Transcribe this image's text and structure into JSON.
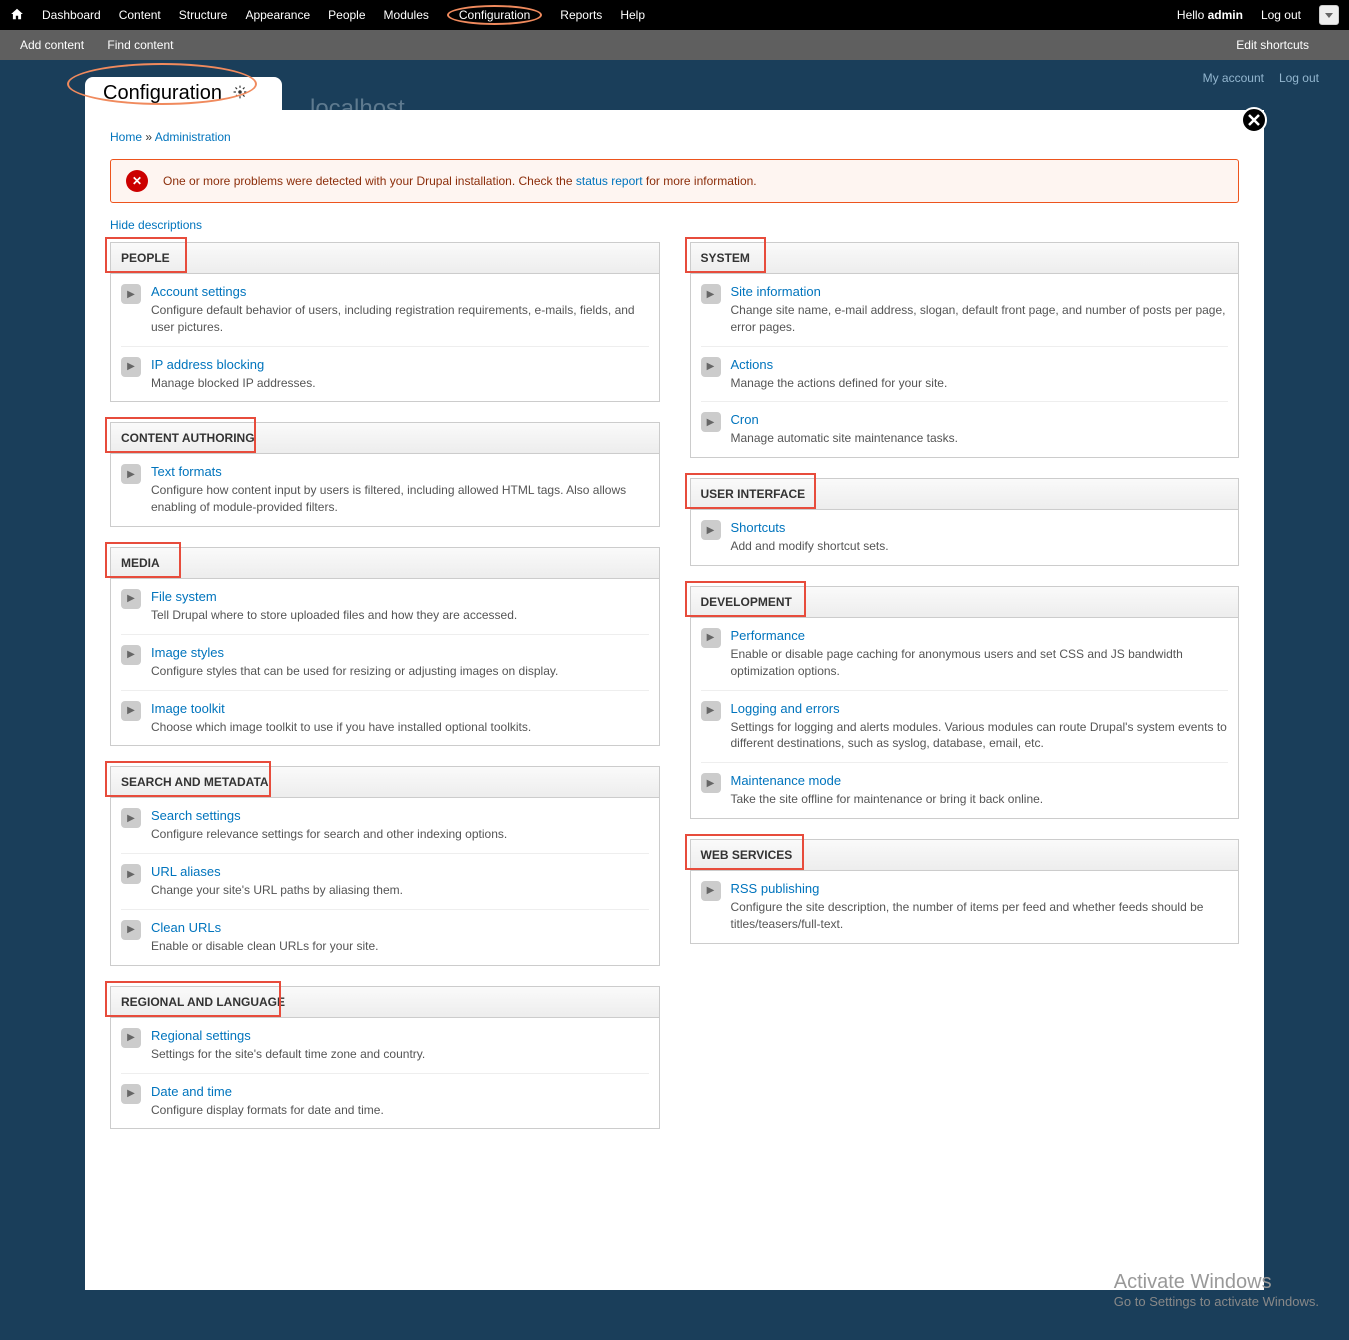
{
  "topbar": {
    "items": [
      "Dashboard",
      "Content",
      "Structure",
      "Appearance",
      "People",
      "Modules",
      "Configuration",
      "Reports",
      "Help"
    ],
    "hello": "Hello",
    "user": "admin",
    "logout": "Log out"
  },
  "shortcutbar": {
    "add": "Add content",
    "find": "Find content",
    "edit": "Edit shortcuts"
  },
  "userbar": {
    "account": "My account",
    "logout": "Log out"
  },
  "site_title": "localhost",
  "overlay_title": "Configuration",
  "breadcrumb": {
    "home": "Home",
    "sep": " » ",
    "admin": "Administration"
  },
  "status": {
    "pre": "One or more problems were detected with your Drupal installation. Check the ",
    "link": "status report",
    "post": " for more information."
  },
  "hide_desc": "Hide descriptions",
  "left_panels": [
    {
      "title": "PEOPLE",
      "box": "box-people",
      "items": [
        {
          "link": "Account settings",
          "desc": "Configure default behavior of users, including registration requirements, e-mails, fields, and user pictures."
        },
        {
          "link": "IP address blocking",
          "desc": "Manage blocked IP addresses."
        }
      ]
    },
    {
      "title": "CONTENT AUTHORING",
      "box": "box-content",
      "items": [
        {
          "link": "Text formats",
          "desc": "Configure how content input by users is filtered, including allowed HTML tags. Also allows enabling of module-provided filters."
        }
      ]
    },
    {
      "title": "MEDIA",
      "box": "box-media",
      "items": [
        {
          "link": "File system",
          "desc": "Tell Drupal where to store uploaded files and how they are accessed."
        },
        {
          "link": "Image styles",
          "desc": "Configure styles that can be used for resizing or adjusting images on display."
        },
        {
          "link": "Image toolkit",
          "desc": "Choose which image toolkit to use if you have installed optional toolkits."
        }
      ]
    },
    {
      "title": "SEARCH AND METADATA",
      "box": "box-search",
      "items": [
        {
          "link": "Search settings",
          "desc": "Configure relevance settings for search and other indexing options."
        },
        {
          "link": "URL aliases",
          "desc": "Change your site's URL paths by aliasing them."
        },
        {
          "link": "Clean URLs",
          "desc": "Enable or disable clean URLs for your site."
        }
      ]
    },
    {
      "title": "REGIONAL AND LANGUAGE",
      "box": "box-regional",
      "items": [
        {
          "link": "Regional settings",
          "desc": "Settings for the site's default time zone and country."
        },
        {
          "link": "Date and time",
          "desc": "Configure display formats for date and time."
        }
      ]
    }
  ],
  "right_panels": [
    {
      "title": "SYSTEM",
      "box": "box-system",
      "items": [
        {
          "link": "Site information",
          "desc": "Change site name, e-mail address, slogan, default front page, and number of posts per page, error pages."
        },
        {
          "link": "Actions",
          "desc": "Manage the actions defined for your site."
        },
        {
          "link": "Cron",
          "desc": "Manage automatic site maintenance tasks."
        }
      ]
    },
    {
      "title": "USER INTERFACE",
      "box": "box-ui",
      "items": [
        {
          "link": "Shortcuts",
          "desc": "Add and modify shortcut sets."
        }
      ]
    },
    {
      "title": "DEVELOPMENT",
      "box": "box-dev",
      "items": [
        {
          "link": "Performance",
          "desc": "Enable or disable page caching for anonymous users and set CSS and JS bandwidth optimization options."
        },
        {
          "link": "Logging and errors",
          "desc": "Settings for logging and alerts modules. Various modules can route Drupal's system events to different destinations, such as syslog, database, email, etc."
        },
        {
          "link": "Maintenance mode",
          "desc": "Take the site offline for maintenance or bring it back online."
        }
      ]
    },
    {
      "title": "WEB SERVICES",
      "box": "box-ws",
      "items": [
        {
          "link": "RSS publishing",
          "desc": "Configure the site description, the number of items per feed and whether feeds should be titles/teasers/full-text."
        }
      ]
    }
  ],
  "watermark": {
    "title": "Activate Windows",
    "sub": "Go to Settings to activate Windows."
  }
}
